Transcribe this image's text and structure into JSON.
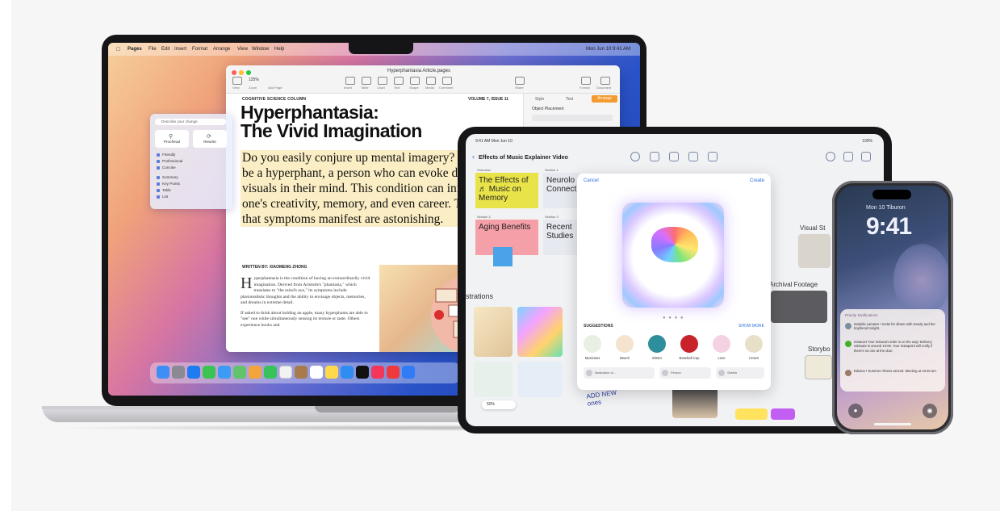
{
  "mac": {
    "menubar": {
      "app": "Pages",
      "items": [
        "File",
        "Edit",
        "Insert",
        "Format",
        "Arrange",
        "View",
        "Window",
        "Help"
      ],
      "clock": "Mon Jun 10  9:41 AM"
    },
    "pages_window": {
      "doc_title": "Hyperphantasia Article.pages",
      "zoom": "125%",
      "toolbar_labels": [
        "View",
        "Zoom",
        "Add Page",
        "Insert",
        "Table",
        "Chart",
        "Text",
        "Shape",
        "Media",
        "Comment",
        "Share",
        "Format",
        "Document"
      ],
      "sidebar_tabs": [
        "Style",
        "Text",
        "Arrange"
      ],
      "sidebar_object_label": "Object Placement",
      "article": {
        "column_label": "COGNITIVE SCIENCE COLUMN",
        "issue_label": "VOLUME 7, ISSUE 11",
        "headline_line1": "Hyperphantasia:",
        "headline_line2": "The Vivid Imagination",
        "lead_lines": [
          "Do you easily conjure up mental imagery? Yo",
          "be a hyperphant, a person who can evoke det",
          "visuals in their mind. This condition can infl",
          "one's creativity, memory, and even career. Th",
          "that symptoms manifest are astonishing."
        ],
        "byline": "WRITTEN BY: XIAOMENG ZHONG",
        "body_dropcap": "H",
        "body_para1": "yperphantasia is the condition of having an extraordinarily vivid imagination. Derived from Aristotle's \"phantasia,\" which translates to \"the mind's eye,\" its symptoms include photorealistic thoughts and the ability to envisage objects, memories, and dreams in extreme detail.",
        "body_para2": "If asked to think about holding an apple, many hyperphants are able to \"see\" one while simultaneously sensing its texture or taste. Others experience books and"
      }
    },
    "writing_tools": {
      "search_placeholder": "Describe your change",
      "proofread_label": "Proofread",
      "rewrite_label": "Rewrite",
      "items": [
        "Friendly",
        "Professional",
        "Concise",
        "Summary",
        "Key Points",
        "Table",
        "List"
      ]
    }
  },
  "ipad": {
    "status_time": "9:41 AM  Mon Jun 10",
    "status_right": "100%",
    "board_title": "Effects of Music Explainer Video",
    "stickies": [
      {
        "text": "The Effects of ♬ Music on Memory",
        "color": "#e9e34a"
      },
      {
        "text": "Neurolo Connect",
        "color": "#e7e9f0"
      },
      {
        "text": "Aging Benefits",
        "color": "#f5a0a8"
      },
      {
        "text": "Recent Studies",
        "color": "#e7e9f0"
      }
    ],
    "section_labels": [
      "Overview",
      "Section 1",
      "Section 2",
      "Section 3"
    ],
    "illustrations_title": "strations",
    "zoom": "50%",
    "right_labels": [
      "Visual St",
      "Archival Footage",
      "Storybo"
    ],
    "handwriting": "ADD NEW ones",
    "dialog": {
      "cancel": "Cancel",
      "create": "Create",
      "suggestions_title": "SUGGESTIONS",
      "show_more": "SHOW MORE",
      "suggestions": [
        "Musicians",
        "Beach",
        "Winter",
        "Baseball Cap",
        "Love",
        "Crown"
      ],
      "chips": [
        "Illustration of ...",
        "Person",
        "Sketch"
      ],
      "page_dots": "● ● ● ●"
    }
  },
  "iphone": {
    "status_left": "9:41",
    "date_line": "Mon 10  Tiburon",
    "time": "9:41",
    "notification_header": "Priority Notifications",
    "notifications": [
      {
        "sender": "Isabella Lamarre",
        "text": "Isabella Lamarre • Invite for dinner with Sandy and her boyfriend tonight."
      },
      {
        "sender": "Instacart",
        "text": "Instacart Your Instacart order is on the way! Delivery estimate is around 10:00. Your Instapoint will notify if there's no one at the door."
      },
      {
        "sender": "Edwina",
        "text": "Edwina • Summer Athens arrived. Meeting at 10:30 am."
      }
    ]
  }
}
